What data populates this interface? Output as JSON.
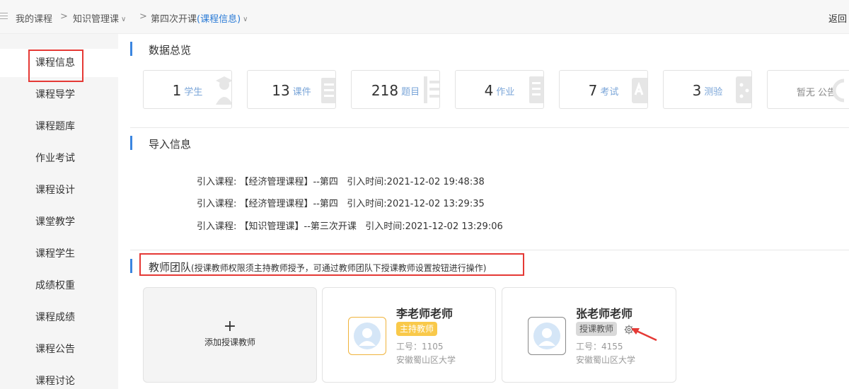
{
  "breadcrumb": {
    "items": [
      "我的课程",
      "知识管理课",
      "第四次开课"
    ],
    "separator": ">",
    "current_suffix": "(课程信息)",
    "back_label": "返回"
  },
  "sidebar": {
    "items": [
      {
        "label": "课程信息",
        "active": true
      },
      {
        "label": "课程导学"
      },
      {
        "label": "课程题库"
      },
      {
        "label": "作业考试"
      },
      {
        "label": "课程设计"
      },
      {
        "label": "课堂教学"
      },
      {
        "label": "课程学生"
      },
      {
        "label": "成绩权重"
      },
      {
        "label": "课程成绩"
      },
      {
        "label": "课程公告"
      },
      {
        "label": "课程讨论"
      }
    ]
  },
  "overview": {
    "title": "数据总览",
    "stats": [
      {
        "value": "1",
        "label": "学生"
      },
      {
        "value": "13",
        "label": "课件"
      },
      {
        "value": "218",
        "label": "题目"
      },
      {
        "value": "4",
        "label": "作业"
      },
      {
        "value": "7",
        "label": "考试"
      },
      {
        "value": "3",
        "label": "测验"
      },
      {
        "value": "暂无 公告",
        "label": ""
      }
    ]
  },
  "import": {
    "title": "导入信息",
    "lines": [
      "引入课程: 【经济管理课程】--第四   引入时间:2021-12-02 19:48:38",
      "引入课程: 【经济管理课程】--第四   引入时间:2021-12-02 13:29:35",
      "引入课程: 【知识管理课】--第三次开课   引入时间:2021-12-02 13:29:06"
    ]
  },
  "team": {
    "title": "教师团队",
    "note": "(授课教师权限须主持教师授予，可通过教师团队下授课教师设置按钮进行操作)",
    "add_label": "添加授课教师",
    "add_symbol": "+",
    "teachers": [
      {
        "name": "李老师老师",
        "role": "主持教师",
        "id": "工号：1105",
        "school": "安徽蜀山区大学",
        "role_color": "#f9c94a"
      },
      {
        "name": "张老师老师",
        "role": "授课教师",
        "id": "工号：4155",
        "school": "安徽蜀山区大学",
        "role_color": "#d9d9d9"
      }
    ]
  },
  "colors": {
    "accent": "#3b86e0",
    "highlight_box": "#e53935",
    "link": "#2b7bd6"
  }
}
